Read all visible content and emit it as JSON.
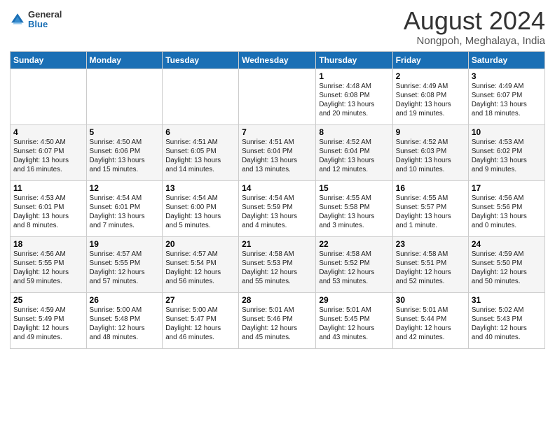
{
  "header": {
    "logo_general": "General",
    "logo_blue": "Blue",
    "title": "August 2024",
    "location": "Nongpoh, Meghalaya, India"
  },
  "weekdays": [
    "Sunday",
    "Monday",
    "Tuesday",
    "Wednesday",
    "Thursday",
    "Friday",
    "Saturday"
  ],
  "weeks": [
    [
      {
        "day": "",
        "info": ""
      },
      {
        "day": "",
        "info": ""
      },
      {
        "day": "",
        "info": ""
      },
      {
        "day": "",
        "info": ""
      },
      {
        "day": "1",
        "info": "Sunrise: 4:48 AM\nSunset: 6:08 PM\nDaylight: 13 hours\nand 20 minutes."
      },
      {
        "day": "2",
        "info": "Sunrise: 4:49 AM\nSunset: 6:08 PM\nDaylight: 13 hours\nand 19 minutes."
      },
      {
        "day": "3",
        "info": "Sunrise: 4:49 AM\nSunset: 6:07 PM\nDaylight: 13 hours\nand 18 minutes."
      }
    ],
    [
      {
        "day": "4",
        "info": "Sunrise: 4:50 AM\nSunset: 6:07 PM\nDaylight: 13 hours\nand 16 minutes."
      },
      {
        "day": "5",
        "info": "Sunrise: 4:50 AM\nSunset: 6:06 PM\nDaylight: 13 hours\nand 15 minutes."
      },
      {
        "day": "6",
        "info": "Sunrise: 4:51 AM\nSunset: 6:05 PM\nDaylight: 13 hours\nand 14 minutes."
      },
      {
        "day": "7",
        "info": "Sunrise: 4:51 AM\nSunset: 6:04 PM\nDaylight: 13 hours\nand 13 minutes."
      },
      {
        "day": "8",
        "info": "Sunrise: 4:52 AM\nSunset: 6:04 PM\nDaylight: 13 hours\nand 12 minutes."
      },
      {
        "day": "9",
        "info": "Sunrise: 4:52 AM\nSunset: 6:03 PM\nDaylight: 13 hours\nand 10 minutes."
      },
      {
        "day": "10",
        "info": "Sunrise: 4:53 AM\nSunset: 6:02 PM\nDaylight: 13 hours\nand 9 minutes."
      }
    ],
    [
      {
        "day": "11",
        "info": "Sunrise: 4:53 AM\nSunset: 6:01 PM\nDaylight: 13 hours\nand 8 minutes."
      },
      {
        "day": "12",
        "info": "Sunrise: 4:54 AM\nSunset: 6:01 PM\nDaylight: 13 hours\nand 7 minutes."
      },
      {
        "day": "13",
        "info": "Sunrise: 4:54 AM\nSunset: 6:00 PM\nDaylight: 13 hours\nand 5 minutes."
      },
      {
        "day": "14",
        "info": "Sunrise: 4:54 AM\nSunset: 5:59 PM\nDaylight: 13 hours\nand 4 minutes."
      },
      {
        "day": "15",
        "info": "Sunrise: 4:55 AM\nSunset: 5:58 PM\nDaylight: 13 hours\nand 3 minutes."
      },
      {
        "day": "16",
        "info": "Sunrise: 4:55 AM\nSunset: 5:57 PM\nDaylight: 13 hours\nand 1 minute."
      },
      {
        "day": "17",
        "info": "Sunrise: 4:56 AM\nSunset: 5:56 PM\nDaylight: 13 hours\nand 0 minutes."
      }
    ],
    [
      {
        "day": "18",
        "info": "Sunrise: 4:56 AM\nSunset: 5:55 PM\nDaylight: 12 hours\nand 59 minutes."
      },
      {
        "day": "19",
        "info": "Sunrise: 4:57 AM\nSunset: 5:55 PM\nDaylight: 12 hours\nand 57 minutes."
      },
      {
        "day": "20",
        "info": "Sunrise: 4:57 AM\nSunset: 5:54 PM\nDaylight: 12 hours\nand 56 minutes."
      },
      {
        "day": "21",
        "info": "Sunrise: 4:58 AM\nSunset: 5:53 PM\nDaylight: 12 hours\nand 55 minutes."
      },
      {
        "day": "22",
        "info": "Sunrise: 4:58 AM\nSunset: 5:52 PM\nDaylight: 12 hours\nand 53 minutes."
      },
      {
        "day": "23",
        "info": "Sunrise: 4:58 AM\nSunset: 5:51 PM\nDaylight: 12 hours\nand 52 minutes."
      },
      {
        "day": "24",
        "info": "Sunrise: 4:59 AM\nSunset: 5:50 PM\nDaylight: 12 hours\nand 50 minutes."
      }
    ],
    [
      {
        "day": "25",
        "info": "Sunrise: 4:59 AM\nSunset: 5:49 PM\nDaylight: 12 hours\nand 49 minutes."
      },
      {
        "day": "26",
        "info": "Sunrise: 5:00 AM\nSunset: 5:48 PM\nDaylight: 12 hours\nand 48 minutes."
      },
      {
        "day": "27",
        "info": "Sunrise: 5:00 AM\nSunset: 5:47 PM\nDaylight: 12 hours\nand 46 minutes."
      },
      {
        "day": "28",
        "info": "Sunrise: 5:01 AM\nSunset: 5:46 PM\nDaylight: 12 hours\nand 45 minutes."
      },
      {
        "day": "29",
        "info": "Sunrise: 5:01 AM\nSunset: 5:45 PM\nDaylight: 12 hours\nand 43 minutes."
      },
      {
        "day": "30",
        "info": "Sunrise: 5:01 AM\nSunset: 5:44 PM\nDaylight: 12 hours\nand 42 minutes."
      },
      {
        "day": "31",
        "info": "Sunrise: 5:02 AM\nSunset: 5:43 PM\nDaylight: 12 hours\nand 40 minutes."
      }
    ]
  ]
}
